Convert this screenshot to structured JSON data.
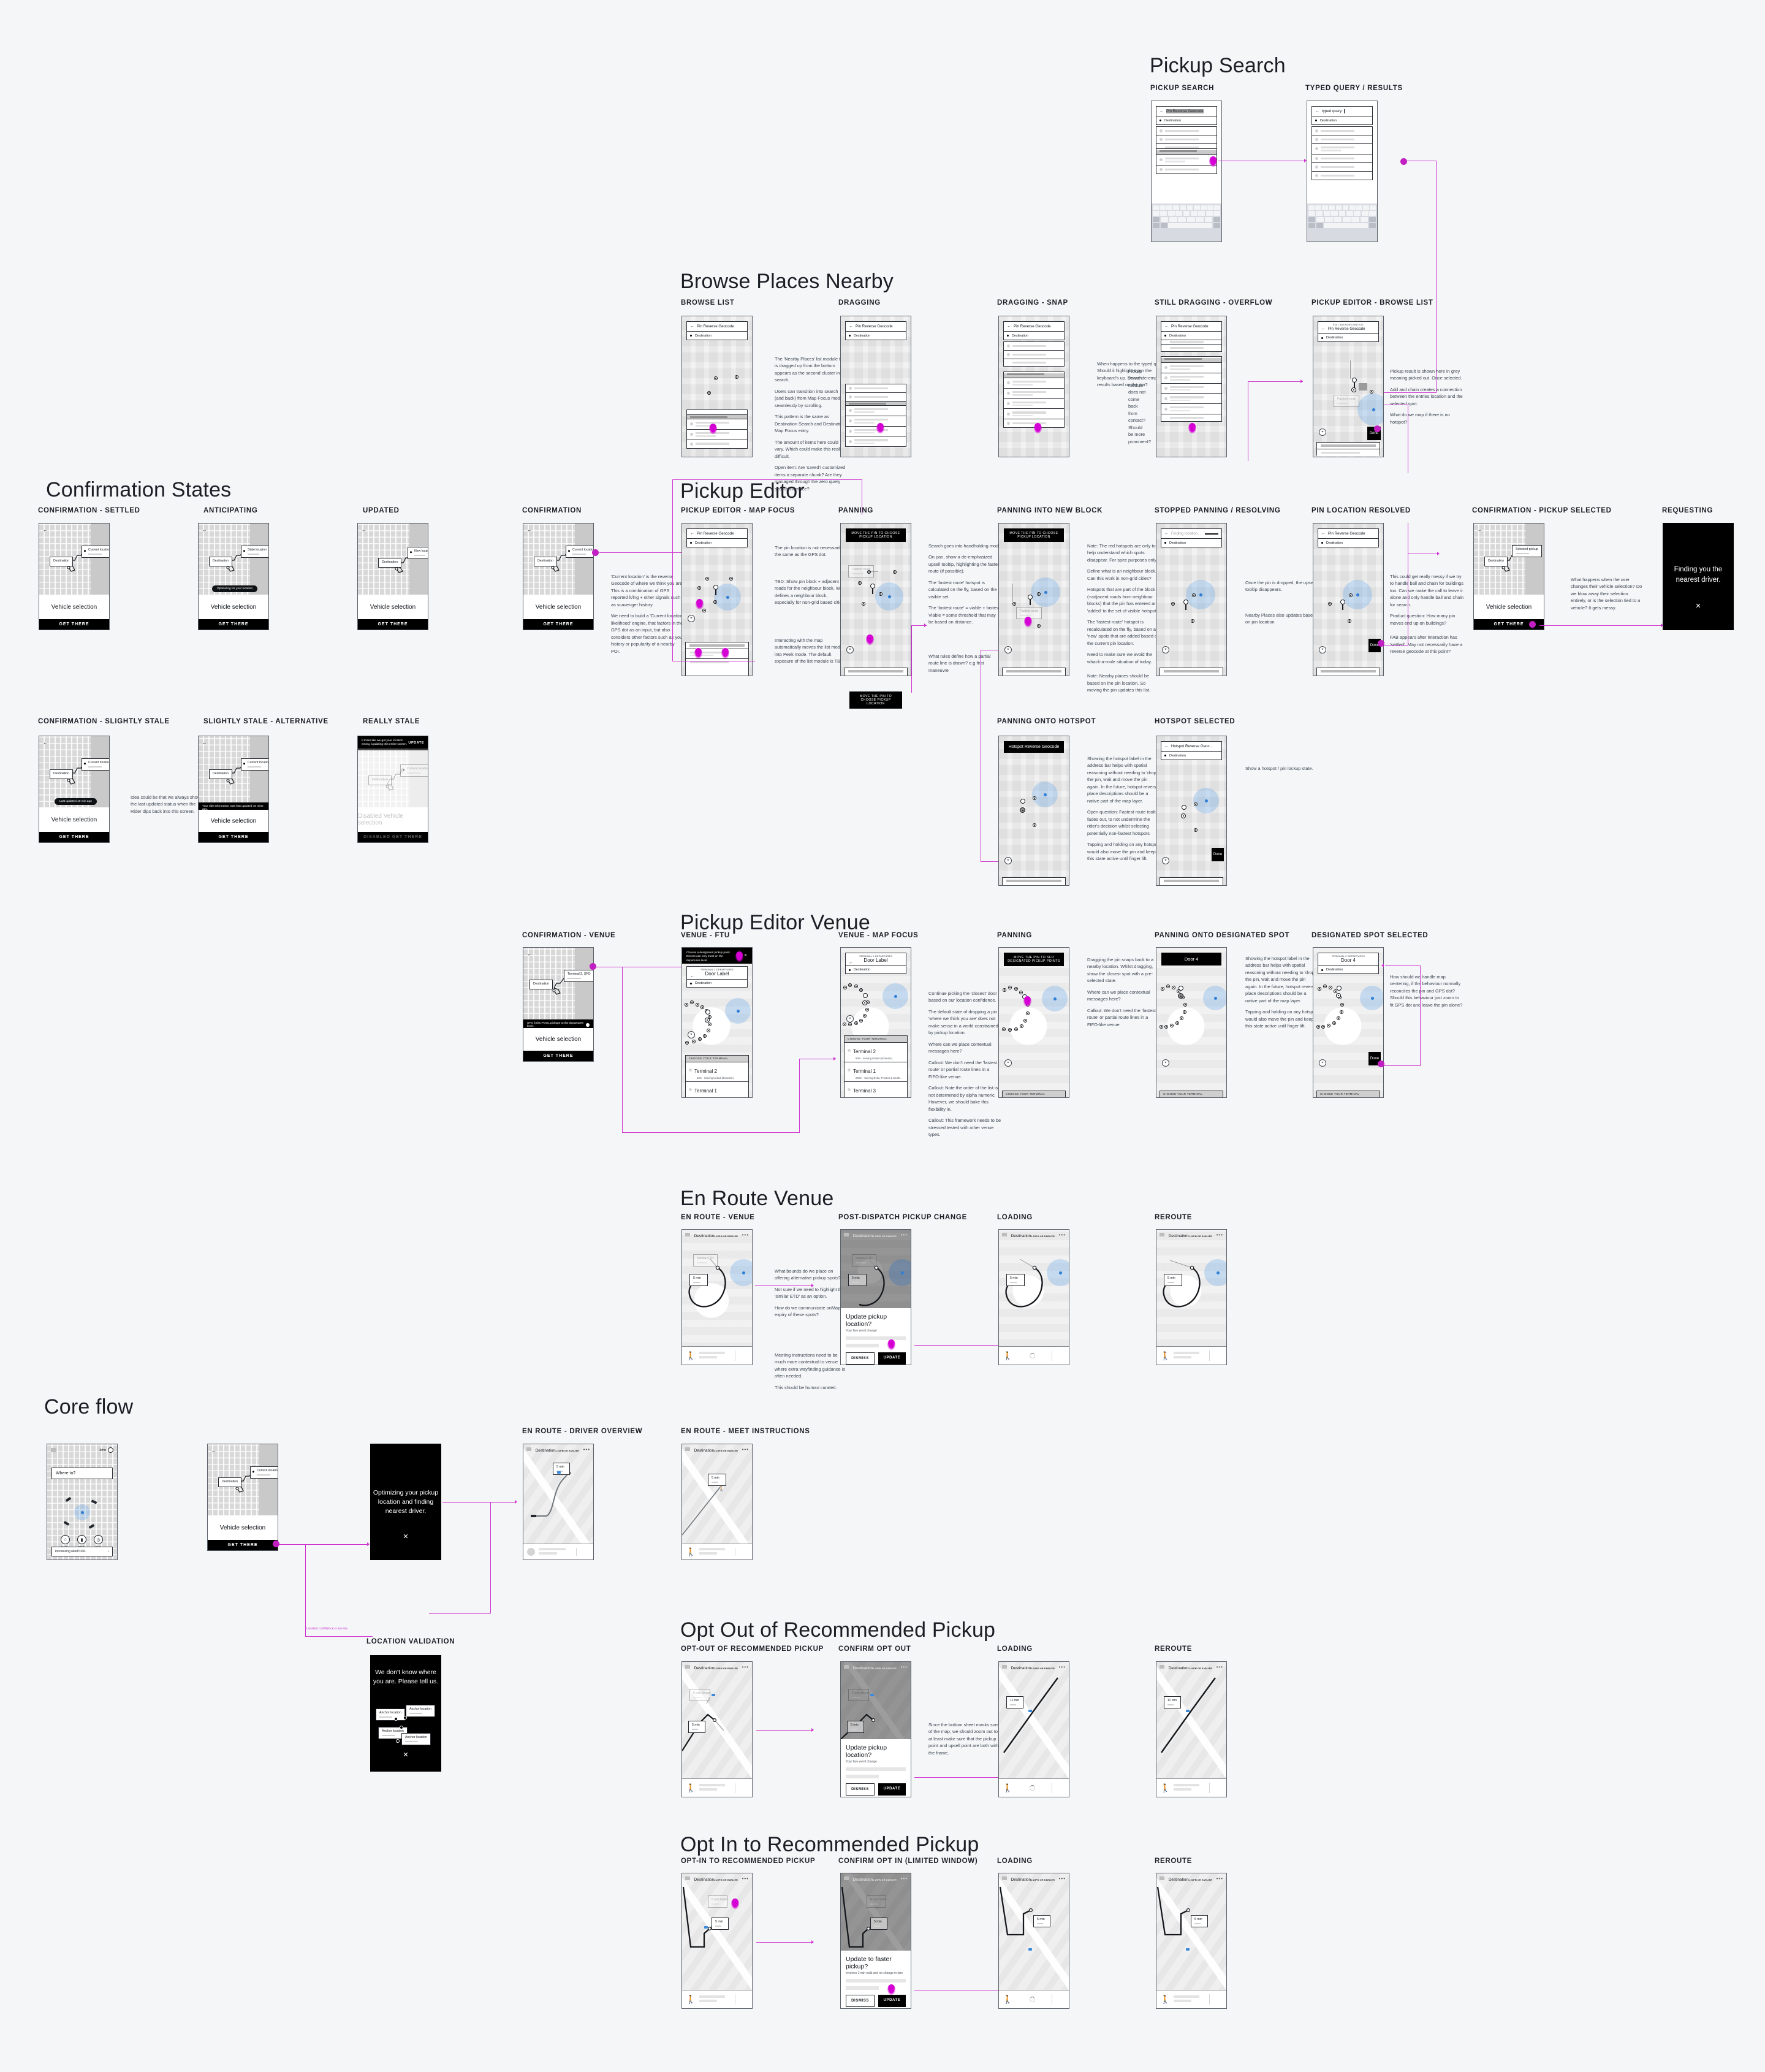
{
  "meta": {
    "accent": "#cf33cf",
    "tap_color": "#c21fc2",
    "canvas_bg": "#f4f6f8"
  },
  "sections": {
    "pickup_search": {
      "title": "Pickup Search"
    },
    "browse_places": {
      "title": "Browse Places Nearby"
    },
    "confirmation_states": {
      "title": "Confirmation States"
    },
    "pickup_editor": {
      "title": "Pickup Editor"
    },
    "pickup_editor_venue": {
      "title": "Pickup Editor Venue"
    },
    "en_route_venue": {
      "title": "En Route Venue"
    },
    "core_flow": {
      "title": "Core flow"
    },
    "opt_out": {
      "title": "Opt Out of Recommended Pickup"
    },
    "opt_in": {
      "title": "Opt In to Recommended Pickup"
    }
  },
  "labels": {
    "pickup_search": "PICKUP SEARCH",
    "typed_query": "TYPED QUERY / RESULTS",
    "browse_list": "BROWSE LIST",
    "dragging": "DRAGGING",
    "dragging_snap": "DRAGGING - SNAP",
    "still_dragging": "STILL DRAGGING - OVERFLOW",
    "pe_browse_list": "PICKUP EDITOR - BROWSE LIST",
    "conf_settled": "CONFIRMATION - SETTLED",
    "anticipating": "ANTICIPATING",
    "updated": "UPDATED",
    "conf_slightly_stale": "CONFIRMATION - SLIGHTLY STALE",
    "slightly_stale_alt": "SLIGHTLY STALE - ALTERNATIVE",
    "really_stale": "REALLY STALE",
    "confirmation": "CONFIRMATION",
    "pe_map_focus": "PICKUP EDITOR - MAP FOCUS",
    "panning": "PANNING",
    "panning_new_block": "PANNING INTO NEW BLOCK",
    "stopped_panning": "STOPPED PANNING / RESOLVING",
    "pin_resolved": "PIN LOCATION RESOLVED",
    "conf_pickup_selected": "CONFIRMATION - PICKUP SELECTED",
    "requesting": "REQUESTING",
    "panning_hotspot": "PANNING ONTO HOTSPOT",
    "hotspot_selected": "HOTSPOT SELECTED",
    "conf_venue": "CONFIRMATION - VENUE",
    "venue_ftu": "VENUE - FTU",
    "venue_map_focus": "VENUE - MAP FOCUS",
    "venue_panning": "PANNING",
    "panning_designated": "PANNING ONTO DESIGNATED SPOT",
    "designated_selected": "DESIGNATED SPOT SELECTED",
    "en_route_venue": "EN ROUTE - VENUE",
    "post_dispatch": "POST-DISPATCH PICKUP CHANGE",
    "loading": "LOADING",
    "reroute": "REROUTE",
    "en_route_driver": "EN ROUTE - DRIVER OVERVIEW",
    "en_route_meet": "EN ROUTE - MEET INSTRUCTIONS",
    "location_validation": "LOCATION VALIDATION",
    "opt_out_rec": "OPT-OUT OF RECOMMENDED PICKUP",
    "confirm_opt_out": "CONFIRM OPT OUT",
    "opt_in_rec": "OPT-IN TO RECOMMENDED PICKUP",
    "confirm_opt_in": "CONFIRM OPT IN (LIMITED WINDOW)"
  },
  "ui": {
    "pin_reverse_geocode": "Pin Reverse Geocode",
    "hotspot_reverse_geocode": "Hotspot Reverse Geocode",
    "hotspot_reverse_geocode_trunc": "Hotspot Reverse Geoc...",
    "finding_location": "Finding location...",
    "typed_query": "typed query",
    "destination": "Destination",
    "back_arrow": "←",
    "poi_anchor_context": "POI / ANCHOR CONTEXT",
    "vehicle_selection": "Vehicle selection",
    "disabled_vehicle_selection": "Disabled Vehicle selection",
    "get_there": "GET THERE",
    "disabled_get_there": "DISABLED GET THERE",
    "current_location": "Current location",
    "stale_location": "Stale location",
    "new_location": "New location",
    "selected_pickup": "Selected pickup",
    "terminal2_sfo": "Terminal 2, SFO",
    "optimizing_toast": "Optimizing for your location",
    "last_updated_toast": "Last updated 10 min ago",
    "stale_alt_banner": "Your ride information was last updated 10 mins ago.",
    "really_stale_banner": "It looks like we got your location wrong. Updating this entire screen.",
    "update": "UPDATE",
    "requesting_msg": "Finding you the nearest driver.",
    "optimizing_msg": "Optimizing your pickup location and finding nearest driver.",
    "location_validation_msg": "We don't know where you are. Please tell us.",
    "anchor_location": "Anchor location",
    "close_x": "✕",
    "move_pin_tip": "MOVE THE PIN TO CHOOSE PICKUP LOCATION",
    "move_pin_venue_tip": "MOVE THE PIN TO SFO DESIGNATED PICKUP POINTS",
    "fastest_route": "Fastest route",
    "done": "Done",
    "sfo_limits_banner": "SFO limits POOL pickups to the departures level.",
    "venue_ftu_msg": "Choose a designated pickup point. Drivers can only meet on the departures level.",
    "terminal_kicker": "TERMINAL 2 DEPARTURES",
    "door_label": "Door Label",
    "door_4": "Door 4",
    "choose_your_terminal": "CHOOSE YOUR TERMINAL",
    "terminals": [
      {
        "name": "Terminal 2",
        "sub": "50m · Serving United (domestic)"
      },
      {
        "name": "Terminal 1",
        "sub": "200m · Serving Delta, Frontier & South..."
      },
      {
        "name": "Terminal 3",
        "sub": ""
      }
    ],
    "er_destination": "Destination",
    "er_eta": "1:23PM OR EARLIER",
    "eta_5min": "5 min",
    "eta_11min": "11 min",
    "similar_eta": "Similar ETD",
    "six_min_slower": "6 min slower",
    "six_min_faster": "6 min faster",
    "update_pickup_title": "Update pickup location?",
    "update_pickup_sub": "Your fare won't change",
    "update_faster_title": "Update to faster pickup?",
    "update_faster_sub": "Involves 2 min walk and no change in fare",
    "dismiss": "DISMISS",
    "update_btn": "UPDATE",
    "where_to": "Where to?",
    "user_name": "John",
    "shortcuts": [
      {
        "label": "Home",
        "icon": "home-icon"
      },
      {
        "label": "Work",
        "icon": "briefcase-icon"
      },
      {
        "label": "Gym",
        "icon": "clock-icon"
      }
    ],
    "uberpool_promo": "Introducing uberPOOL",
    "chevron": "›"
  },
  "connector_labels": {
    "low_confidence": "Location confidence is too low"
  },
  "notes": {
    "browse_list": [
      "The 'Nearby Places' list module that is dragged up from the bottom appears as the second cluster in search.",
      "Users can transition into search (and back) from Map Focus mode seamlessly by scrolling.",
      "This pattern is the same as Destination Search and Destination Map Focus entry.",
      "The amount of items here could vary. Which could make this really difficult.",
      "Open item: Are 'saved'/ customized items a separate chunk? Are they managed through the zero query search interface?"
    ],
    "dragging_snap": [
      "When happens to the typed query? Should it highlight upon the keyboard's up. Do we de-emphasize results based on the pin?"
    ],
    "still_dragging": [
      "Pickup search module does not come back from contact? Should be more prominent?"
    ],
    "confirmation": [
      "'Current location' is the reverse Geocode of where we think you are. This is a combination of GPS reported lt/lng + other signals such as scavenger history.",
      "We need to build a 'Current location likelihood' engine, that factors in the GPS dot as an input, but also considers other factors such as your history or popularity of a nearby POI."
    ],
    "pe_map_focus": [
      "The pin location is not necessarily the same as the GPS dot.",
      "TBD: Show pin block + adjacent roads for the neighbour block. What defines a neighbour block, especially for non-grid based cities?",
      "Interacting with the map automatically moves the list module into Peek mode. The default exposure of the list module is TBD."
    ],
    "panning": [
      "Search goes into handholding mode",
      "On pan, show a de-emphasized upsell tooltip, highlighting the fastest route (if possible).",
      "The 'fastest route' hotspot is calculated on the fly, based on the visible set.",
      "The 'fastest route' = viable + fastest. Viable = some threshold that may be based on distance.",
      "What rules define how a partial route line is drawn? e.g first maneuvre"
    ],
    "panning_new_block": [
      "Note: The red hotspots are only to help understand which spots disappear. For spec purposes only.",
      "Define what is an neighbour block. Can this work in non-grid cities?",
      "Hotspots that are part of the block (+adjacent roads from neighbour blocks) that the pin has entered are 'added' to the set of visible hotspots.",
      "The 'fastest route' hotspot is recalculated on the fly, based on any 'new' spots that are added based on the current pin location.",
      "Need to make sure we avoid the whack-a-mole situation of today.",
      "Note: Nearby places should be based on the pin location. So moving the pin updates this list."
    ],
    "stopped_panning": [
      "Once the pin is dropped, the upsell tooltip disappears.",
      "Nearby Places also updates based on pin location"
    ],
    "pin_resolved": [
      "This could get really messy if we try to handle ball and chain for buildings too. Can we make the call to leave it alone and only handle ball and chain for search.",
      "Product question: How many pin moves end up on buildings?",
      "FAB appears after interaction has 'settled'. May not necessarily have a reverse geocode at this point?"
    ],
    "conf_pickup_selected": [
      "What happens when the user changes their vehicle selection? Do we blow away their selection entirely, or is the selection tied to a vehicle? It gets messy."
    ],
    "panning_hotspot": [
      "Showing the hotspot label in the address bar helps with spatial reasoning without needing to 'drop' the pin, wait and move the pin again. In the future, hotspot reverse place descriptions should be a native part of the map layer.",
      "Open question: Fastest route tooltip fades out, to not undermine the rider's decision whilst selecting potentially non-fastest hotspots",
      "Tapping and holding on any hotspot, would also move the pin and keep this state active until finger lift."
    ],
    "hotspot_selected": [
      "Show a hotspot / pin lockup state."
    ],
    "venue_map_focus": [
      "Continue picking the 'closest' door based on our location confidence.",
      "The default state of dropping a pin 'where we think you are' does not make sense in a world constrained by pickup location.",
      "Where can we place contextual messages here?",
      "Callout: We don't need the 'fastest route' or partial route lines in a FIFO-like venue.",
      "Callout: Note the order of the list is not determined by alpha numeric. However, we should bake this flexibility in.",
      "Callout: This framework needs to be stressed tested with other venue types."
    ],
    "venue_panning": [
      "Dragging the pin snaps back to a nearby location. Whilst dragging, show the closest spot with a pre-selected state.",
      "Where can we place contextual messages here?",
      "Callout: We don't need the 'fastest route' or partial route lines in a FIFO-like venue."
    ],
    "panning_designated": [
      "Showing the hotspot label in the address bar helps with spatial reasoning without needing to 'drop' the pin, wait and move the pin again. In the future, hotspot reverse place descriptions should be a native part of the map layer.",
      "Tapping and holding on any hotspot, would also move the pin and keep this state active until finger lift."
    ],
    "designated_selected": [
      "How should we handle map centering, if the behaviour normally reconciles the pin and GPS dot? Should this behaviour just zoom to fit GPS dot and leave the pin alone?"
    ],
    "en_route_venue": [
      "What bounds do we place on offering alternative pickup spots?",
      "Not sure if we need to highlight the 'similar ETD' as an option.",
      "How do we communicate onMap expiry of these spots?",
      "Meeting instructions need to be much more contextual to venue where extra wayfinding guidance is often needed.",
      "This should be human curated."
    ],
    "confirm_opt_out": [
      "Since the bottom sheet masks some of the map, we should zoom out to at least make sure that the pickup point and upsell point are both within the frame."
    ],
    "conf_slightly_stale": [
      "Idea could be that we always show the last updated status when the Rider dips back into this screen."
    ]
  }
}
